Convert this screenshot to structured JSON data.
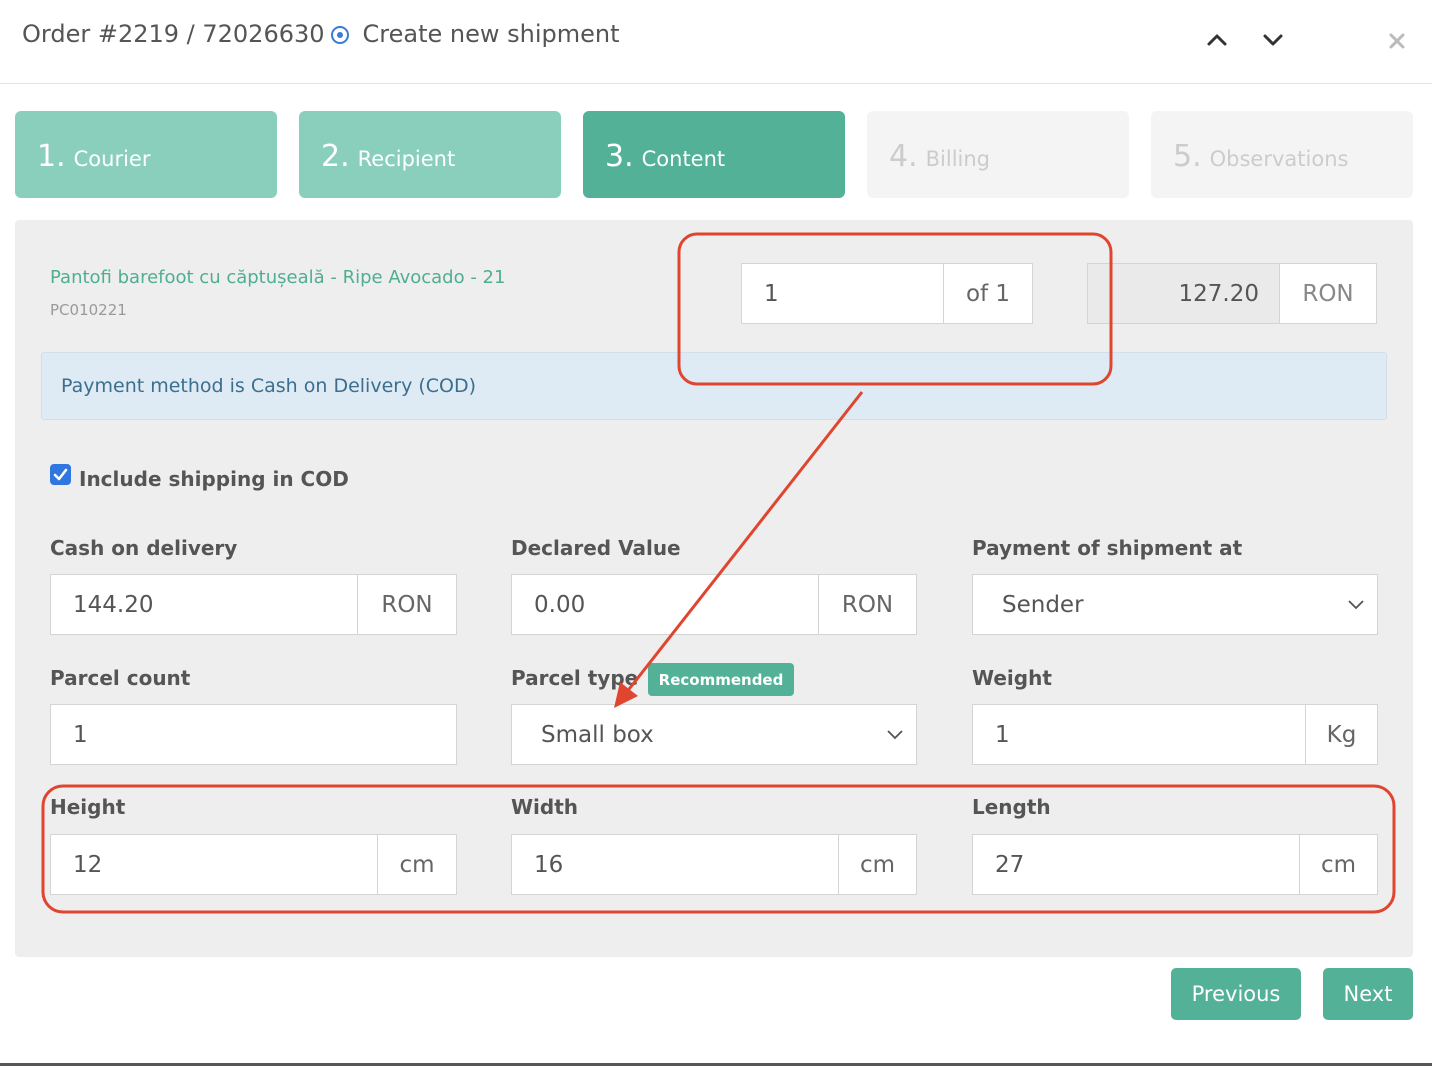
{
  "header": {
    "order": "Order #2219 / 72026630",
    "title": "Create new shipment"
  },
  "steps": [
    {
      "num": "1.",
      "label": "Courier",
      "state": "done"
    },
    {
      "num": "2.",
      "label": "Recipient",
      "state": "done"
    },
    {
      "num": "3.",
      "label": "Content",
      "state": "active"
    },
    {
      "num": "4.",
      "label": "Billing",
      "state": "disabled"
    },
    {
      "num": "5.",
      "label": "Observations",
      "state": "disabled"
    }
  ],
  "product": {
    "name": "Pantofi barefoot cu căptușeală - Ripe Avocado - 21",
    "sku": "PC010221",
    "quantity": "1",
    "of_label": "of 1",
    "price": "127.20",
    "currency": "RON"
  },
  "alert": "Payment method is Cash on Delivery (COD)",
  "include_shipping": {
    "label": "Include shipping in COD",
    "checked": true
  },
  "form": {
    "cod": {
      "label": "Cash on delivery",
      "value": "144.20",
      "unit": "RON"
    },
    "declared": {
      "label": "Declared Value",
      "value": "0.00",
      "unit": "RON"
    },
    "payment_at": {
      "label": "Payment of shipment at",
      "value": "Sender"
    },
    "parcel_count": {
      "label": "Parcel count",
      "value": "1"
    },
    "parcel_type": {
      "label": "Parcel type",
      "badge": "Recommended",
      "value": "Small box"
    },
    "weight": {
      "label": "Weight",
      "value": "1",
      "unit": "Kg"
    },
    "height": {
      "label": "Height",
      "value": "12",
      "unit": "cm"
    },
    "width": {
      "label": "Width",
      "value": "16",
      "unit": "cm"
    },
    "length": {
      "label": "Length",
      "value": "27",
      "unit": "cm"
    }
  },
  "buttons": {
    "previous": "Previous",
    "next": "Next"
  },
  "colors": {
    "accent": "#52b196",
    "accent_light": "#8acfbc",
    "annotation": "#e0452f",
    "checkbox": "#2f76e0"
  }
}
